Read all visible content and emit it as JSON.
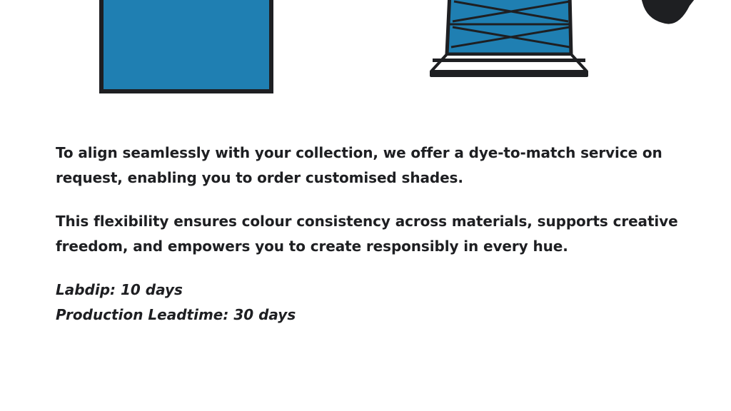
{
  "colors": {
    "fabric_blue": "#1f7fb2",
    "outline": "#1e1f22",
    "background": "#ffffff"
  },
  "illustration": {
    "icons": [
      "fabric-swatch-icon",
      "yarn-cone-icon",
      "dye-drop-icon"
    ]
  },
  "description": {
    "paragraph_1": "To align seamlessly with your collection, we offer a dye-to-match service on request, enabling you to order customised shades.",
    "paragraph_2": "This flexibility ensures colour consistency across materials, supports creative freedom, and empowers you to create responsibly in every hue."
  },
  "leadtimes": {
    "labdip": "Labdip: 10 days",
    "production": "Production Leadtime: 30 days"
  }
}
